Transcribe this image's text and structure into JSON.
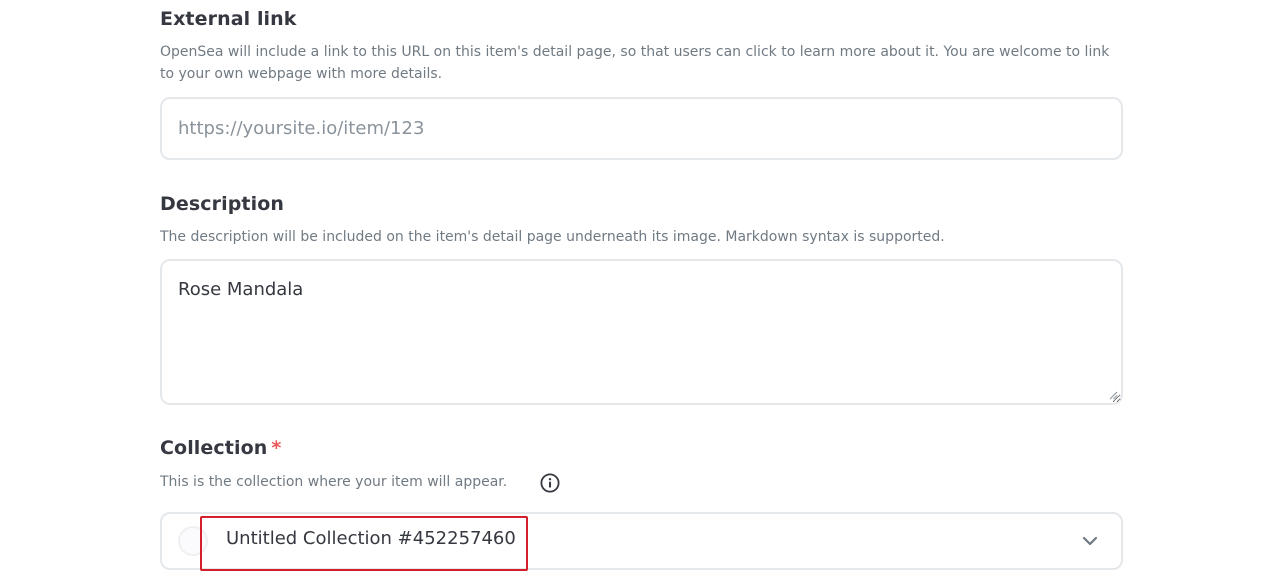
{
  "external_link": {
    "title": "External link",
    "description": "OpenSea will include a link to this URL on this item's detail page, so that users can click to learn more about it. You are welcome to link to your own webpage with more details.",
    "placeholder": "https://yoursite.io/item/123",
    "value": ""
  },
  "description_field": {
    "title": "Description",
    "description": "The description will be included on the item's detail page underneath its image. Markdown syntax is supported.",
    "value": "Rose Mandala"
  },
  "collection": {
    "title": "Collection",
    "required_marker": "*",
    "description": "This is the collection where your item will appear.",
    "info_icon": "info-circle-icon",
    "selected_value": "Untitled Collection #452257460",
    "dropdown_icon": "chevron-down-icon",
    "highlight_color": "#d61f2c"
  },
  "colors": {
    "title_text": "#353840",
    "muted_text": "#707a83",
    "border": "#e5e8eb",
    "placeholder": "#8a939b",
    "required": "#eb5757"
  }
}
